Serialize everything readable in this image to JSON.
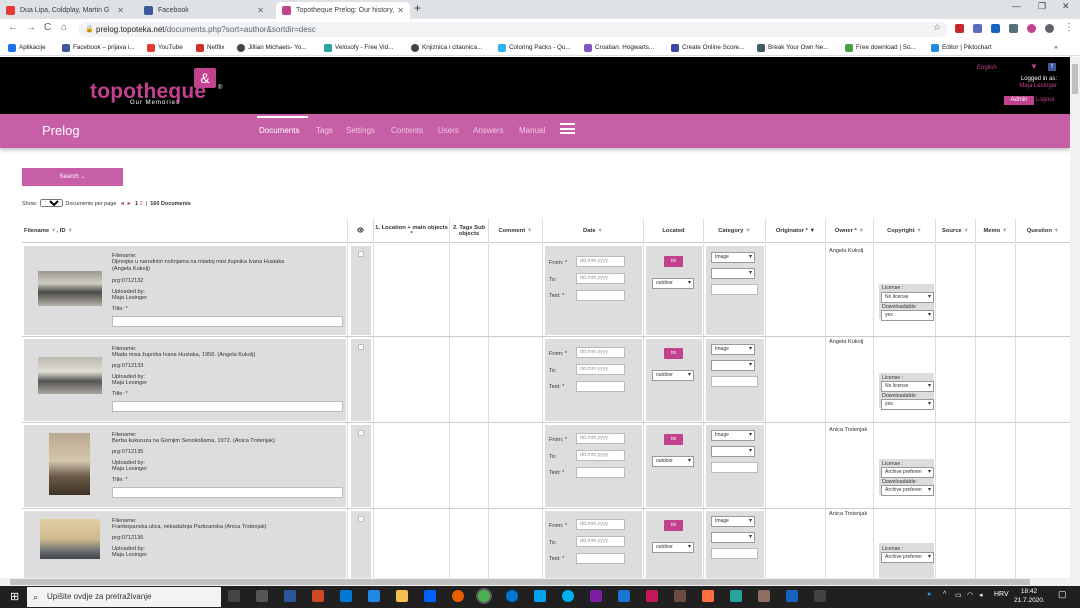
{
  "browser": {
    "tabs": [
      {
        "title": "Dua Lipa, Coldplay, Martin G"
      },
      {
        "title": "Facebook"
      },
      {
        "title": "Topotheque Prelog: Our history,"
      }
    ],
    "new_tab_icon": "+",
    "url_host": "prelog.topoteka.net",
    "url_path": "/documents.php?sort=author&sortdir=desc",
    "bookmarks": [
      {
        "label": "Aplikacije"
      },
      {
        "label": "Facebook – prijava i..."
      },
      {
        "label": "YouTube"
      },
      {
        "label": "Netflix"
      },
      {
        "label": "Jillian Michaels- Yo..."
      },
      {
        "label": "Velosofy - Free Vid..."
      },
      {
        "label": "Knjiznica i citaonica..."
      },
      {
        "label": "Coloring Packs - Qu..."
      },
      {
        "label": "Croatian: Hogwarts..."
      },
      {
        "label": "Create Online Score..."
      },
      {
        "label": "Break Your Own Ne..."
      },
      {
        "label": "Free download | So..."
      },
      {
        "label": "Editor | Piktochart"
      }
    ]
  },
  "site": {
    "logo_text": "topotheque",
    "logo_sub": "Our Memories",
    "language": "English",
    "logged_in_as": "Logged in as:",
    "user_name": "Maja Lesinger",
    "admin_label": "Admin",
    "logout_label": "Logout",
    "name": "Prelog",
    "nav": [
      "Documents",
      "Tags",
      "Settings",
      "Contents",
      "Users",
      "Answers",
      "Manual"
    ],
    "accent": "#c2428f",
    "nav_bg": "#c75fa6"
  },
  "search_label": "Search",
  "show": {
    "prefix": "Show:",
    "value": "100",
    "suffix": "Documents per page",
    "page_prev": "◄",
    "page_next": "►",
    "page1": "1",
    "page2": "2",
    "separator": "|",
    "total": "160 Documents"
  },
  "columns": {
    "filename": "Filename",
    "id": "ID",
    "eye_icon": "eye-icon",
    "location": "1. Location + main objects *",
    "tags": "2. Tags Sub objects",
    "comment": "Comment",
    "date": "Date",
    "located": "Located",
    "category": "Category",
    "originator": "Originator *",
    "owner": "Owner *",
    "copyright": "Copyright",
    "source": "Source",
    "memo": "Memo",
    "question": "Question"
  },
  "form": {
    "filename_label": "Filename:",
    "uploaded_label": "Uploaded by:",
    "title_label": "Title: *",
    "from_label": "From: *",
    "to_label": "To:",
    "text_label": "Text: *",
    "date_placeholder": "dd.mm.yyyy",
    "no_label": "no",
    "located_select": "outdoor",
    "category_select": "Image",
    "license_label": "License :",
    "downloadable_label": "Downloadable:"
  },
  "rows": [
    {
      "filename": "Djevojke u narodnim nošnjama na mladoj misi župnika Ivana Hustaka",
      "filename2": "(Angela Kukolj)",
      "id": "prg:0712132",
      "uploader": "Maja Lesinger",
      "owner": "Angela Kukolj",
      "license": "No license",
      "downloadable": "yes"
    },
    {
      "filename": "Mlada misa župnika Ivana Hustaka, 1956. (Angela Kukolj)",
      "filename2": "",
      "id": "prg:0712133",
      "uploader": "Maja Lesinger",
      "owner": "Angela Kukolj",
      "license": "No license",
      "downloadable": "yes"
    },
    {
      "filename": "Berba kukuruza na Gornjim Senokošama, 1972. (Anica Trstenjak)",
      "filename2": "",
      "id": "prg:0712135",
      "uploader": "Maja Lesinger",
      "owner": "Anica Trstenjak",
      "license": "Archive preferen",
      "downloadable": "Archive preferen"
    },
    {
      "filename": "Frankopanska ulica, nekadašnja Partizanska (Anica Trstenjak)",
      "filename2": "",
      "id": "prg:0712136",
      "uploader": "Maja Lesinger",
      "owner": "Anica Trstenjak",
      "license": "Archive preferen",
      "downloadable": ""
    }
  ],
  "taskbar": {
    "search_placeholder": "Upišite ovdje za pretraživanje",
    "language": "HRV",
    "time": "18:42",
    "date": "21.7.2020."
  }
}
